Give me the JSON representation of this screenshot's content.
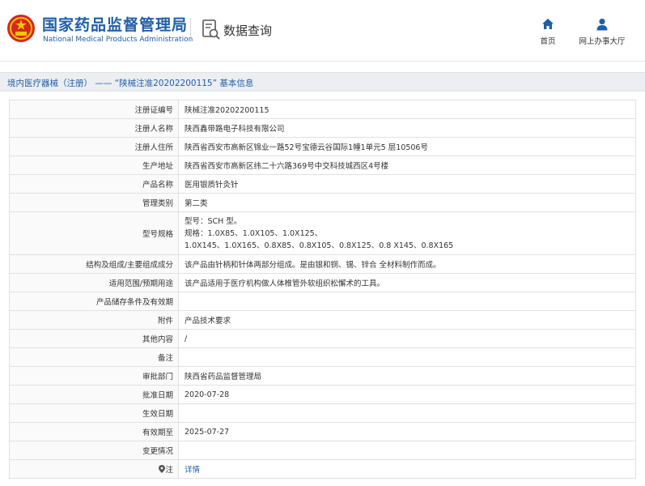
{
  "header": {
    "brand_cn": "国家药品监督管理局",
    "brand_en": "National Medical Products Administration",
    "query_label": "数据查询",
    "nav": [
      {
        "label": "首页",
        "icon": "home-icon"
      },
      {
        "label": "网上办事大厅",
        "icon": "user-icon"
      }
    ]
  },
  "breadcrumb": {
    "category": "境内医疗器械（注册）",
    "separator": "——",
    "item": "“陕械注准20202200115”",
    "suffix": "基本信息"
  },
  "colors": {
    "brand_blue": "#1f5ea8",
    "crumb_bg": "#eceef1",
    "border": "#e1e1e1"
  },
  "rows": [
    {
      "key": "注册证编号",
      "value": "陕械注准20202200115"
    },
    {
      "key": "注册人名称",
      "value": "陕西鑫带路电子科技有限公司"
    },
    {
      "key": "注册人住所",
      "value": "陕西省西安市高新区锦业一路52号宝德云谷国际1幢1单元5 层10506号"
    },
    {
      "key": "生产地址",
      "value": "陕西省西安市高新区纬二十六路369号中交科技城西区4号楼"
    },
    {
      "key": "产品名称",
      "value": "医用银质针灸针"
    },
    {
      "key": "管理类别",
      "value": "第二类"
    },
    {
      "key": "型号规格",
      "lines": [
        "型号：SCH 型。",
        "规格：1.0X85、1.0X105、1.0X125、",
        "1.0X145、1.0X165、0.8X85、0.8X105、0.8X125、0.8 X145、0.8X165"
      ]
    },
    {
      "key": "结构及组成/主要组成成分",
      "value": "该产品由针柄和针体两部分组成。是由银和铜、锡、锌合 全材料制作而成。"
    },
    {
      "key": "适用范围/预期用途",
      "value": "该产品适用于医疗机构做人体椎管外软组织松懈术的工具。"
    },
    {
      "key": "产品储存条件及有效期",
      "value": ""
    },
    {
      "key": "附件",
      "value": "产品技术要求"
    },
    {
      "key": "其他内容",
      "value": "/"
    },
    {
      "key": "备注",
      "value": ""
    },
    {
      "key": "审批部门",
      "value": "陕西省药品监督管理局"
    },
    {
      "key": "批准日期",
      "value": "2020-07-28"
    },
    {
      "key": "生效日期",
      "value": ""
    },
    {
      "key": "有效期至",
      "value": "2025-07-27"
    },
    {
      "key": "变更情况",
      "value": ""
    },
    {
      "key": "注",
      "value": "详情",
      "key_icon": "pin-icon"
    }
  ]
}
